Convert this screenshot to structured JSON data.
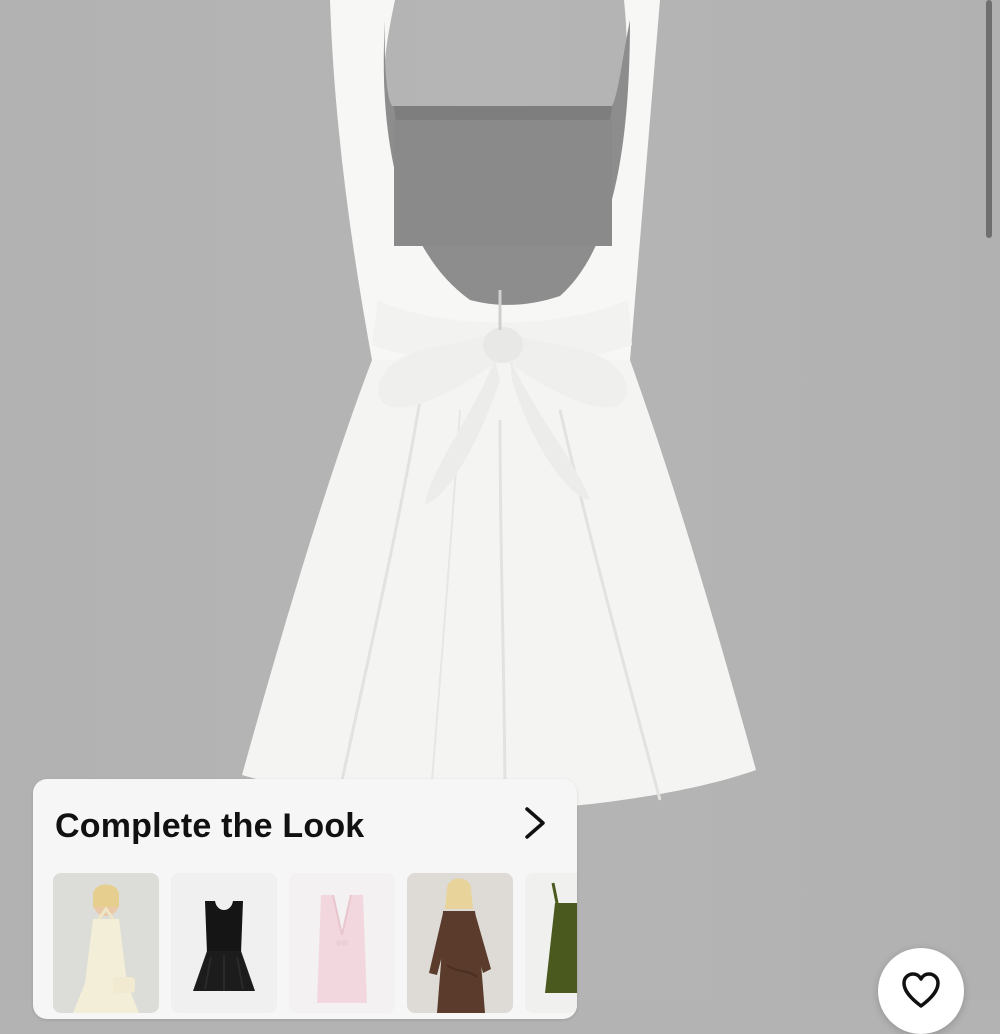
{
  "product": {
    "image": "white-backless-bow-mini-dress"
  },
  "complete_the_look": {
    "title": "Complete the Look",
    "arrow_icon": "chevron-right-icon",
    "items": [
      {
        "image": "cream-halter-mini-dress"
      },
      {
        "image": "black-sweetheart-mini-dress"
      },
      {
        "image": "pink-plunge-mini-dress"
      },
      {
        "image": "brown-long-sleeve-wrap-dress"
      },
      {
        "image": "olive-tie-strap-dress"
      }
    ]
  },
  "favorite": {
    "icon": "heart-icon"
  },
  "colors": {
    "background": "#b3b3b3",
    "card": "#f6f6f6",
    "title": "#111111"
  }
}
